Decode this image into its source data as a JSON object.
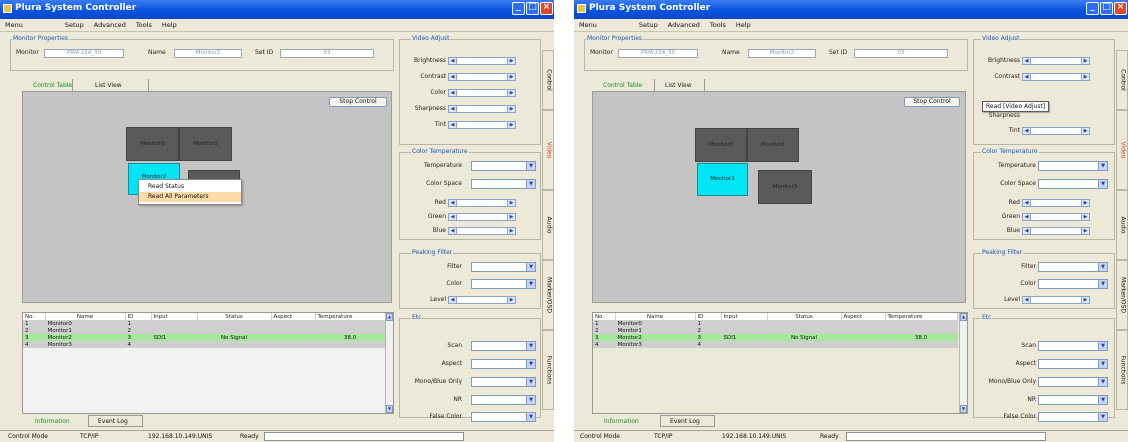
{
  "window": {
    "title": "Plura System Controller",
    "menu": [
      "Menu",
      "Setup",
      "Advanced",
      "Tools",
      "Help"
    ]
  },
  "monitor_properties": {
    "group_label": "Monitor Properties",
    "monitor_label": "Monitor",
    "monitor_value": "PRM-224_30",
    "name_label": "Name",
    "name_value": "Monitor2",
    "setid_label": "Set ID",
    "setid_value": "03"
  },
  "view_tabs": [
    "Control Table",
    "List View"
  ],
  "canvas": {
    "stop_control_left": "Stop Control",
    "stop_control_right": "Stop Control",
    "monitors": [
      "Monitor0",
      "Monitor1",
      "Monitor2",
      "Monitor3"
    ]
  },
  "context_menu": [
    "Read Status",
    "Read All Parameters"
  ],
  "tooltip_right": "Read [Video Adjust]",
  "table": {
    "headers": [
      "No.",
      "Name",
      "ID",
      "Input",
      "Status",
      "Aspect",
      "Temperature"
    ],
    "rows": [
      [
        "1",
        "Monitor0",
        "1",
        "",
        "",
        "",
        ""
      ],
      [
        "2",
        "Monitor1",
        "2",
        "",
        "",
        "",
        ""
      ],
      [
        "3",
        "Monitor2",
        "3",
        "SDI1",
        "No Signal",
        "",
        "38.0"
      ],
      [
        "4",
        "Monitor3",
        "4",
        "",
        "",
        "",
        ""
      ]
    ],
    "selected_row": 2
  },
  "bottom_tabs": [
    "Information",
    "Event Log"
  ],
  "status_bar": {
    "mode_label": "Control Mode",
    "protocol": "TCP/IP",
    "address_left": "192.168.10.149:UNIS",
    "address_right": "192.168.10.149:UNIS",
    "ready": "Ready"
  },
  "video_adjust": {
    "group_label": "Video Adjust",
    "items": [
      "Brightness",
      "Contrast",
      "Color",
      "Sharpness",
      "Tint"
    ]
  },
  "color_temperature": {
    "group_label": "Color Temperature",
    "temperature_label": "Temperature",
    "color_space_label": "Color Space",
    "gains": [
      "Red",
      "Green",
      "Blue"
    ]
  },
  "peaking_filter": {
    "group_label": "Peaking Filter",
    "filter_label": "Filter",
    "color_label": "Color",
    "level_label": "Level"
  },
  "etc": {
    "group_label": "Etc",
    "items": [
      "Scan",
      "Aspect",
      "Mono/Blue Only",
      "NR",
      "False Color"
    ]
  },
  "side_tabs": [
    "Control",
    "Video",
    "Audio",
    "Marker/OSD",
    "Functions"
  ],
  "colors": {
    "title_blue": "#0a54e0",
    "selected_monitor": "#00e5f5",
    "selected_row": "#a4e89a",
    "context_highlight": "#fbdca9",
    "active_side_tab": "#d8341f"
  },
  "icons": {
    "minimize": "minimize-icon",
    "maximize": "maximize-icon",
    "close": "close-icon",
    "slider_left": "arrow-left-icon",
    "slider_right": "arrow-right-icon",
    "dropdown": "chevron-down-icon"
  }
}
